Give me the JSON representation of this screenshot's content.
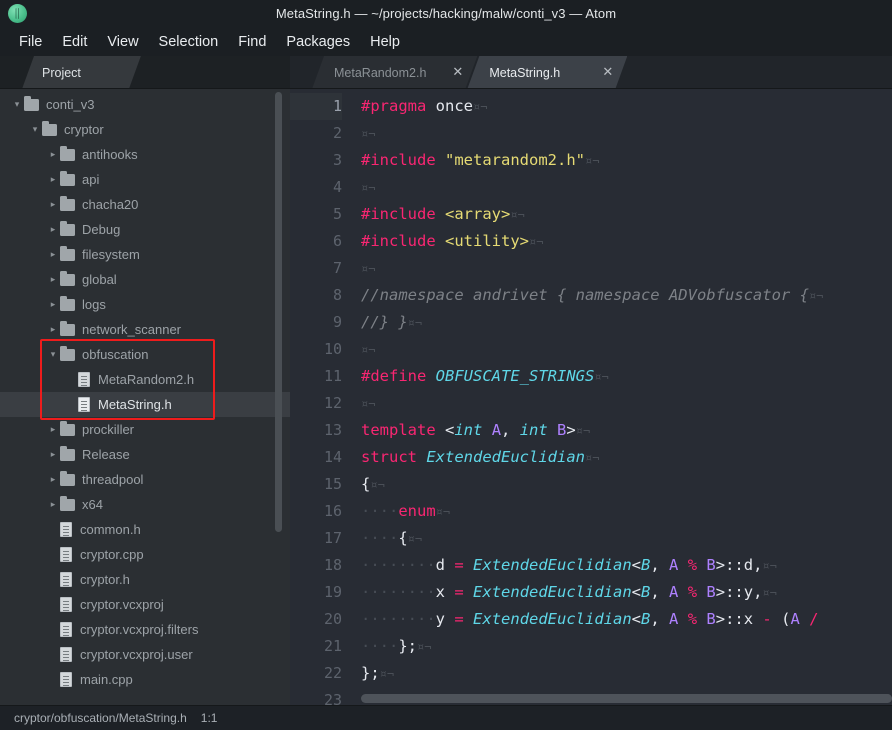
{
  "window": {
    "title": "MetaString.h — ~/projects/hacking/malw/conti_v3 — Atom",
    "logo_icon": "atom-logo-icon"
  },
  "menubar": {
    "items": [
      {
        "label": "File"
      },
      {
        "label": "Edit"
      },
      {
        "label": "View"
      },
      {
        "label": "Selection"
      },
      {
        "label": "Find"
      },
      {
        "label": "Packages"
      },
      {
        "label": "Help"
      }
    ]
  },
  "sidebar": {
    "tab_label": "Project",
    "tree": [
      {
        "label": "conti_v3",
        "type": "folder",
        "state": "open",
        "depth": 0,
        "selected": false
      },
      {
        "label": "cryptor",
        "type": "folder",
        "state": "open",
        "depth": 1,
        "selected": false
      },
      {
        "label": "antihooks",
        "type": "folder",
        "state": "closed",
        "depth": 2,
        "selected": false
      },
      {
        "label": "api",
        "type": "folder",
        "state": "closed",
        "depth": 2,
        "selected": false
      },
      {
        "label": "chacha20",
        "type": "folder",
        "state": "closed",
        "depth": 2,
        "selected": false
      },
      {
        "label": "Debug",
        "type": "folder",
        "state": "closed",
        "depth": 2,
        "selected": false
      },
      {
        "label": "filesystem",
        "type": "folder",
        "state": "closed",
        "depth": 2,
        "selected": false
      },
      {
        "label": "global",
        "type": "folder",
        "state": "closed",
        "depth": 2,
        "selected": false
      },
      {
        "label": "logs",
        "type": "folder",
        "state": "closed",
        "depth": 2,
        "selected": false
      },
      {
        "label": "network_scanner",
        "type": "folder",
        "state": "closed",
        "depth": 2,
        "selected": false
      },
      {
        "label": "obfuscation",
        "type": "folder",
        "state": "open",
        "depth": 2,
        "selected": false
      },
      {
        "label": "MetaRandom2.h",
        "type": "file",
        "state": "none",
        "depth": 3,
        "selected": false
      },
      {
        "label": "MetaString.h",
        "type": "file",
        "state": "none",
        "depth": 3,
        "selected": true
      },
      {
        "label": "prockiller",
        "type": "folder",
        "state": "closed",
        "depth": 2,
        "selected": false
      },
      {
        "label": "Release",
        "type": "folder",
        "state": "closed",
        "depth": 2,
        "selected": false
      },
      {
        "label": "threadpool",
        "type": "folder",
        "state": "closed",
        "depth": 2,
        "selected": false
      },
      {
        "label": "x64",
        "type": "folder",
        "state": "closed",
        "depth": 2,
        "selected": false
      },
      {
        "label": "common.h",
        "type": "file",
        "state": "none",
        "depth": 2,
        "selected": false
      },
      {
        "label": "cryptor.cpp",
        "type": "file",
        "state": "none",
        "depth": 2,
        "selected": false
      },
      {
        "label": "cryptor.h",
        "type": "file",
        "state": "none",
        "depth": 2,
        "selected": false
      },
      {
        "label": "cryptor.vcxproj",
        "type": "file",
        "state": "none",
        "depth": 2,
        "selected": false
      },
      {
        "label": "cryptor.vcxproj.filters",
        "type": "file",
        "state": "none",
        "depth": 2,
        "selected": false
      },
      {
        "label": "cryptor.vcxproj.user",
        "type": "file",
        "state": "none",
        "depth": 2,
        "selected": false
      },
      {
        "label": "main.cpp",
        "type": "file",
        "state": "none",
        "depth": 2,
        "selected": false
      }
    ],
    "annotation": {
      "color": "#ee1c1c",
      "targets": [
        "obfuscation",
        "MetaRandom2.h",
        "MetaString.h"
      ]
    }
  },
  "editor": {
    "tabs": [
      {
        "label": "MetaRandom2.h",
        "active": false,
        "close_icon": "close-icon"
      },
      {
        "label": "MetaString.h",
        "active": true,
        "close_icon": "close-icon"
      }
    ],
    "active_line": 1,
    "lines": [
      {
        "n": "1",
        "tokens": [
          {
            "t": "#pragma",
            "c": "k-pre"
          },
          {
            "t": " ",
            "c": "k-plain"
          },
          {
            "t": "once",
            "c": "k-plain"
          },
          {
            "t": "¤¬",
            "c": "inv"
          }
        ]
      },
      {
        "n": "2",
        "tokens": [
          {
            "t": "¤¬",
            "c": "inv"
          }
        ]
      },
      {
        "n": "3",
        "tokens": [
          {
            "t": "#include",
            "c": "k-pre"
          },
          {
            "t": " ",
            "c": "k-plain"
          },
          {
            "t": "\"metarandom2.h\"",
            "c": "k-str"
          },
          {
            "t": "¤¬",
            "c": "inv"
          }
        ]
      },
      {
        "n": "4",
        "tokens": [
          {
            "t": "¤¬",
            "c": "inv"
          }
        ]
      },
      {
        "n": "5",
        "tokens": [
          {
            "t": "#include",
            "c": "k-pre"
          },
          {
            "t": " ",
            "c": "k-plain"
          },
          {
            "t": "<array>",
            "c": "k-str"
          },
          {
            "t": "¤¬",
            "c": "inv"
          }
        ]
      },
      {
        "n": "6",
        "tokens": [
          {
            "t": "#include",
            "c": "k-pre"
          },
          {
            "t": " ",
            "c": "k-plain"
          },
          {
            "t": "<utility>",
            "c": "k-str"
          },
          {
            "t": "¤¬",
            "c": "inv"
          }
        ]
      },
      {
        "n": "7",
        "tokens": [
          {
            "t": "¤¬",
            "c": "inv"
          }
        ]
      },
      {
        "n": "8",
        "tokens": [
          {
            "t": "//namespace andrivet { namespace ADVobfuscator {",
            "c": "k-cmt"
          },
          {
            "t": "¤¬",
            "c": "inv"
          }
        ]
      },
      {
        "n": "9",
        "tokens": [
          {
            "t": "//} }",
            "c": "k-cmt"
          },
          {
            "t": "¤¬",
            "c": "inv"
          }
        ]
      },
      {
        "n": "10",
        "tokens": [
          {
            "t": "¤¬",
            "c": "inv"
          }
        ]
      },
      {
        "n": "11",
        "tokens": [
          {
            "t": "#define",
            "c": "k-pre"
          },
          {
            "t": " ",
            "c": "k-plain"
          },
          {
            "t": "OBFUSCATE_STRINGS",
            "c": "k-type"
          },
          {
            "t": "¤¬",
            "c": "inv"
          }
        ]
      },
      {
        "n": "12",
        "tokens": [
          {
            "t": "¤¬",
            "c": "inv"
          }
        ]
      },
      {
        "n": "13",
        "tokens": [
          {
            "t": "template",
            "c": "k-kw"
          },
          {
            "t": " ",
            "c": "k-plain"
          },
          {
            "t": "<",
            "c": "k-punc"
          },
          {
            "t": "int",
            "c": "k-type"
          },
          {
            "t": " ",
            "c": "k-plain"
          },
          {
            "t": "A",
            "c": "k-num"
          },
          {
            "t": ", ",
            "c": "k-punc"
          },
          {
            "t": "int",
            "c": "k-type"
          },
          {
            "t": " ",
            "c": "k-plain"
          },
          {
            "t": "B",
            "c": "k-num"
          },
          {
            "t": ">",
            "c": "k-punc"
          },
          {
            "t": "¤¬",
            "c": "inv"
          }
        ]
      },
      {
        "n": "14",
        "tokens": [
          {
            "t": "struct",
            "c": "k-kw"
          },
          {
            "t": " ",
            "c": "k-plain"
          },
          {
            "t": "ExtendedEuclidian",
            "c": "k-type"
          },
          {
            "t": "¤¬",
            "c": "inv"
          }
        ]
      },
      {
        "n": "15",
        "tokens": [
          {
            "t": "{",
            "c": "k-punc"
          },
          {
            "t": "¤¬",
            "c": "inv"
          }
        ]
      },
      {
        "n": "16",
        "tokens": [
          {
            "t": "····",
            "c": "dot"
          },
          {
            "t": "enum",
            "c": "k-kw"
          },
          {
            "t": "¤¬",
            "c": "inv"
          }
        ]
      },
      {
        "n": "17",
        "tokens": [
          {
            "t": "····",
            "c": "dot"
          },
          {
            "t": "{",
            "c": "k-punc"
          },
          {
            "t": "¤¬",
            "c": "inv"
          }
        ]
      },
      {
        "n": "18",
        "tokens": [
          {
            "t": "········",
            "c": "dot"
          },
          {
            "t": "d",
            "c": "k-plain"
          },
          {
            "t": " ",
            "c": "k-plain"
          },
          {
            "t": "=",
            "c": "k-op"
          },
          {
            "t": " ",
            "c": "k-plain"
          },
          {
            "t": "ExtendedEuclidian",
            "c": "k-type"
          },
          {
            "t": "<",
            "c": "k-punc"
          },
          {
            "t": "B",
            "c": "k-type"
          },
          {
            "t": ", ",
            "c": "k-punc"
          },
          {
            "t": "A",
            "c": "k-num"
          },
          {
            "t": " ",
            "c": "k-plain"
          },
          {
            "t": "%",
            "c": "k-op"
          },
          {
            "t": " ",
            "c": "k-plain"
          },
          {
            "t": "B",
            "c": "k-num"
          },
          {
            "t": ">::d,",
            "c": "k-punc"
          },
          {
            "t": "¤¬",
            "c": "inv"
          }
        ]
      },
      {
        "n": "19",
        "tokens": [
          {
            "t": "········",
            "c": "dot"
          },
          {
            "t": "x",
            "c": "k-plain"
          },
          {
            "t": " ",
            "c": "k-plain"
          },
          {
            "t": "=",
            "c": "k-op"
          },
          {
            "t": " ",
            "c": "k-plain"
          },
          {
            "t": "ExtendedEuclidian",
            "c": "k-type"
          },
          {
            "t": "<",
            "c": "k-punc"
          },
          {
            "t": "B",
            "c": "k-type"
          },
          {
            "t": ", ",
            "c": "k-punc"
          },
          {
            "t": "A",
            "c": "k-num"
          },
          {
            "t": " ",
            "c": "k-plain"
          },
          {
            "t": "%",
            "c": "k-op"
          },
          {
            "t": " ",
            "c": "k-plain"
          },
          {
            "t": "B",
            "c": "k-num"
          },
          {
            "t": ">::y,",
            "c": "k-punc"
          },
          {
            "t": "¤¬",
            "c": "inv"
          }
        ]
      },
      {
        "n": "20",
        "tokens": [
          {
            "t": "········",
            "c": "dot"
          },
          {
            "t": "y",
            "c": "k-plain"
          },
          {
            "t": " ",
            "c": "k-plain"
          },
          {
            "t": "=",
            "c": "k-op"
          },
          {
            "t": " ",
            "c": "k-plain"
          },
          {
            "t": "ExtendedEuclidian",
            "c": "k-type"
          },
          {
            "t": "<",
            "c": "k-punc"
          },
          {
            "t": "B",
            "c": "k-type"
          },
          {
            "t": ", ",
            "c": "k-punc"
          },
          {
            "t": "A",
            "c": "k-num"
          },
          {
            "t": " ",
            "c": "k-plain"
          },
          {
            "t": "%",
            "c": "k-op"
          },
          {
            "t": " ",
            "c": "k-plain"
          },
          {
            "t": "B",
            "c": "k-num"
          },
          {
            "t": ">::x ",
            "c": "k-punc"
          },
          {
            "t": "-",
            "c": "k-op"
          },
          {
            "t": " (",
            "c": "k-punc"
          },
          {
            "t": "A",
            "c": "k-num"
          },
          {
            "t": " ",
            "c": "k-plain"
          },
          {
            "t": "/",
            "c": "k-op"
          }
        ]
      },
      {
        "n": "21",
        "tokens": [
          {
            "t": "····",
            "c": "dot"
          },
          {
            "t": "};",
            "c": "k-punc"
          },
          {
            "t": "¤¬",
            "c": "inv"
          }
        ]
      },
      {
        "n": "22",
        "tokens": [
          {
            "t": "};",
            "c": "k-punc"
          },
          {
            "t": "¤¬",
            "c": "inv"
          }
        ]
      },
      {
        "n": "23",
        "tokens": []
      }
    ]
  },
  "statusbar": {
    "path": "cryptor/obfuscation/MetaString.h",
    "cursor": "1:1"
  },
  "colors": {
    "accent_red": "#ee1c1c",
    "keyword_pink": "#f92672",
    "string_yellow": "#e6db74",
    "type_cyan": "#5fd7e8",
    "number_purple": "#ae81ff",
    "comment_gray": "#7d8187",
    "editor_bg": "#282c34",
    "sidebar_bg": "#2b2f33",
    "chrome_bg": "#1d2126"
  }
}
